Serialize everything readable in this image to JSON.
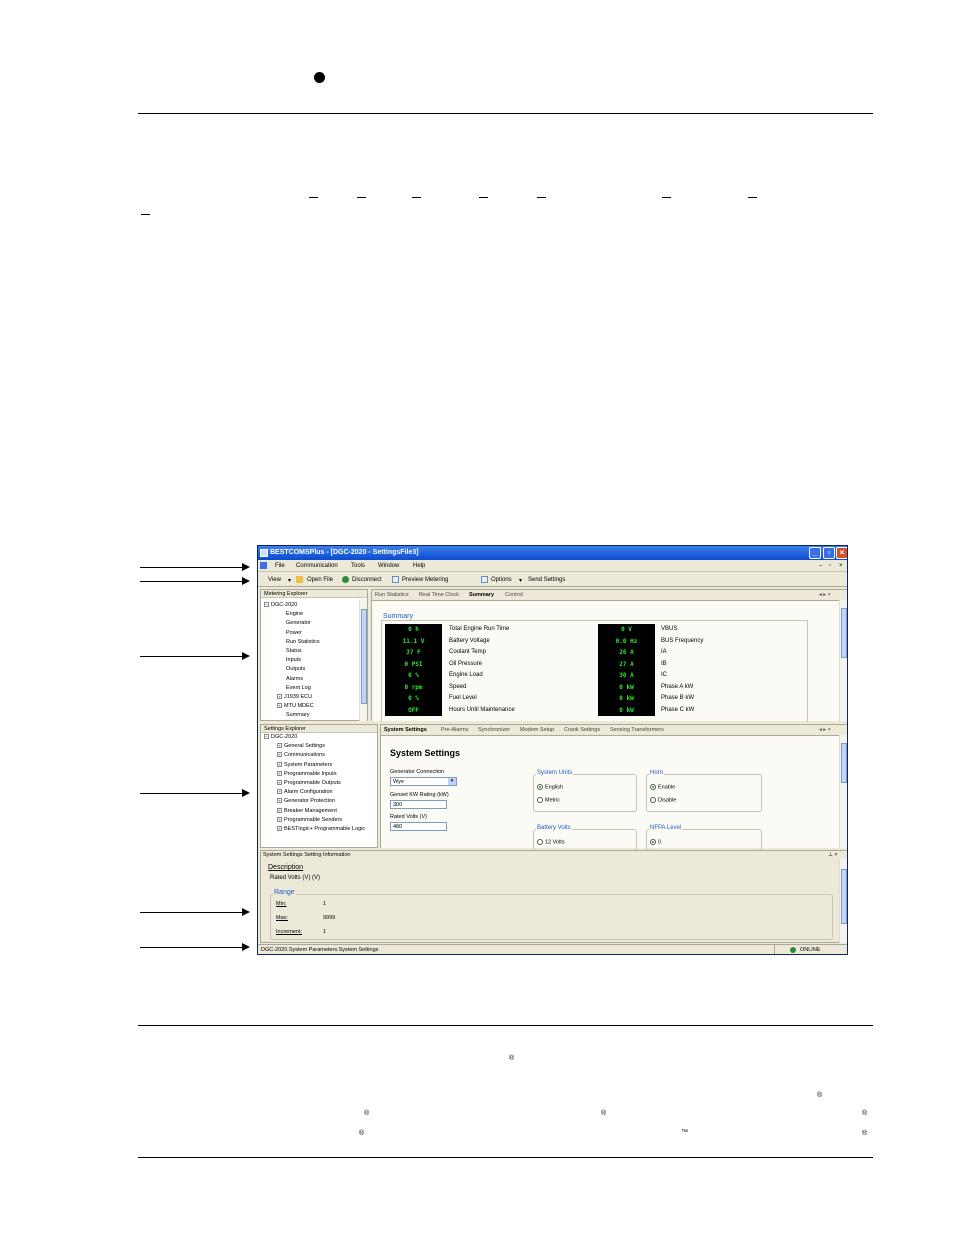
{
  "page": {
    "registered_mark": "®",
    "trademark_mark": "™"
  },
  "window": {
    "title": "BESTCOMSPlus - [DGC-2020 - SettingsFile3]",
    "menu": [
      "File",
      "Communication",
      "Tools",
      "Window",
      "Help"
    ],
    "toolbar": {
      "view": "View",
      "open_file": "Open File",
      "disconnect": "Disconnect",
      "preview_metering": "Preview Metering",
      "options": "Options",
      "send_settings": "Send Settings"
    },
    "metering_explorer": {
      "title": "Metering Explorer",
      "root": "DGC-2020",
      "items": [
        "Engine",
        "Generator",
        "Power",
        "Run Statistics",
        "Status",
        "Inputs",
        "Outputs",
        "Alarms",
        "Event Log",
        "J1939 ECU",
        "MTU MDEC",
        "Summary"
      ]
    },
    "metering_tabs": [
      "Run Statistics",
      "Real Time Clock",
      "Summary",
      "Control"
    ],
    "summary": {
      "heading": "Summary",
      "left": [
        {
          "value": "0 h",
          "label": "Total Engine Run Time"
        },
        {
          "value": "11.1 V",
          "label": "Battery Voltage"
        },
        {
          "value": "37 F",
          "label": "Coolant Temp"
        },
        {
          "value": "0 PSI",
          "label": "Oil Pressure"
        },
        {
          "value": "0 %",
          "label": "Engine Load"
        },
        {
          "value": "0 rpm",
          "label": "Speed"
        },
        {
          "value": "0 %",
          "label": "Fuel Level"
        },
        {
          "value": "OFF",
          "label": "Hours Until Maintenance"
        }
      ],
      "right": [
        {
          "value": "0 V",
          "label": "VBUS"
        },
        {
          "value": "0.0 Hz",
          "label": "BUS Frequency"
        },
        {
          "value": "26 A",
          "label": "IA"
        },
        {
          "value": "27 A",
          "label": "IB"
        },
        {
          "value": "30 A",
          "label": "IC"
        },
        {
          "value": "0 kW",
          "label": "Phase A kW"
        },
        {
          "value": "0 kW",
          "label": "Phase B kW"
        },
        {
          "value": "0 kW",
          "label": "Phase C kW"
        }
      ]
    },
    "settings_explorer": {
      "title": "Settings Explorer",
      "root": "DGC-2020",
      "items": [
        "General Settings",
        "Communications",
        "System Parameters",
        "Programmable Inputs",
        "Programmable Outputs",
        "Alarm Configuration",
        "Generator Protection",
        "Breaker Management",
        "Programmable Senders",
        "BESTlogic+ Programmable Logic"
      ]
    },
    "settings_tabs": [
      "System Settings",
      "Pre-Alarms",
      "Synchronizer",
      "Modem Setup",
      "Crank Settings",
      "Sensing Transformers"
    ],
    "system_settings": {
      "heading": "System Settings",
      "gen_connection_label": "Generator Connection",
      "gen_connection_value": "Wye",
      "kw_rating_label": "Genset KW Rating (kW)",
      "kw_rating_value": "300",
      "rated_volts_label": "Rated Volts (V)",
      "rated_volts_value": "480",
      "system_units_label": "System Units",
      "units_english": "English",
      "units_metric": "Metric",
      "horn_label": "Horn",
      "horn_enable": "Enable",
      "horn_disable": "Disable",
      "battery_volts_label": "Battery Volts",
      "battery_12": "12 Volts",
      "nfpa_label": "NFPA Level",
      "nfpa_0": "0"
    },
    "setting_info": {
      "title": "System Settings Setting Information",
      "description_label": "Description",
      "description_text": "Rated Volts (V) (V)",
      "range_label": "Range",
      "min_label": "Min:",
      "min_value": "1",
      "max_label": "Max:",
      "max_value": "9999",
      "increment_label": "Increment:",
      "increment_value": "1"
    },
    "status": {
      "path": "DGC-2020.System Parameters.System Settings",
      "connection": "ONLINE"
    }
  }
}
